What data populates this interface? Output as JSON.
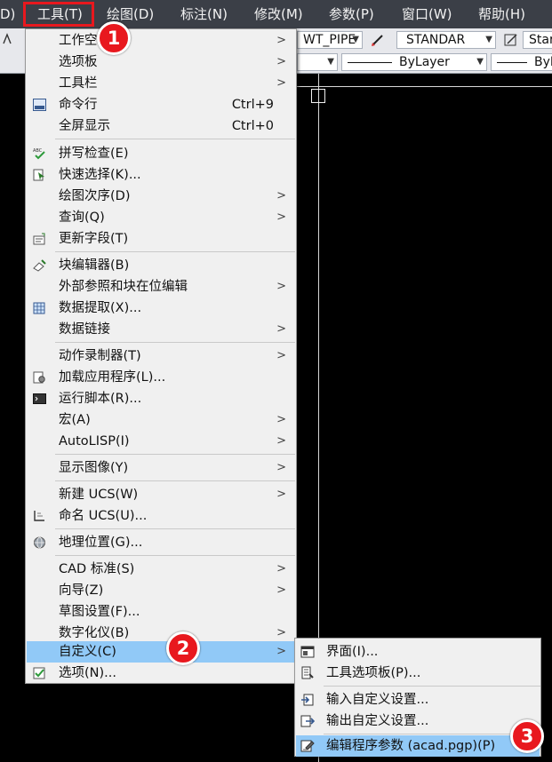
{
  "menubar": {
    "items": [
      "D)",
      "工具(T)",
      "绘图(D)",
      "标注(N)",
      "修改(M)",
      "参数(P)",
      "窗口(W)",
      "帮助(H)"
    ]
  },
  "toolbar1": {
    "combo1": "WT_PIPE",
    "combo2": "STANDAR",
    "combo3": "Star"
  },
  "toolbar2": {
    "combo1": "ByLayer",
    "combo2": "ByL"
  },
  "tools_menu": {
    "items": [
      {
        "label": "工作空间",
        "shortcut": "",
        "submenu": true
      },
      {
        "label": "选项板",
        "shortcut": "",
        "submenu": true
      },
      {
        "label": "工具栏",
        "shortcut": "",
        "submenu": true
      },
      {
        "label": "命令行",
        "shortcut": "Ctrl+9",
        "submenu": false
      },
      {
        "label": "全屏显示",
        "shortcut": "Ctrl+0",
        "submenu": false
      },
      {
        "label": "拼写检查(E)",
        "shortcut": "",
        "submenu": false
      },
      {
        "label": "快速选择(K)...",
        "shortcut": "",
        "submenu": false
      },
      {
        "label": "绘图次序(D)",
        "shortcut": "",
        "submenu": true
      },
      {
        "label": "查询(Q)",
        "shortcut": "",
        "submenu": true
      },
      {
        "label": "更新字段(T)",
        "shortcut": "",
        "submenu": false
      },
      {
        "label": "块编辑器(B)",
        "shortcut": "",
        "submenu": false
      },
      {
        "label": "外部参照和块在位编辑",
        "shortcut": "",
        "submenu": true
      },
      {
        "label": "数据提取(X)...",
        "shortcut": "",
        "submenu": false
      },
      {
        "label": "数据链接",
        "shortcut": "",
        "submenu": true
      },
      {
        "label": "动作录制器(T)",
        "shortcut": "",
        "submenu": true
      },
      {
        "label": "加载应用程序(L)...",
        "shortcut": "",
        "submenu": false
      },
      {
        "label": "运行脚本(R)...",
        "shortcut": "",
        "submenu": false
      },
      {
        "label": "宏(A)",
        "shortcut": "",
        "submenu": true
      },
      {
        "label": "AutoLISP(I)",
        "shortcut": "",
        "submenu": true
      },
      {
        "label": "显示图像(Y)",
        "shortcut": "",
        "submenu": true
      },
      {
        "label": "新建 UCS(W)",
        "shortcut": "",
        "submenu": true
      },
      {
        "label": "命名 UCS(U)...",
        "shortcut": "",
        "submenu": false
      },
      {
        "label": "地理位置(G)...",
        "shortcut": "",
        "submenu": false
      },
      {
        "label": "CAD 标准(S)",
        "shortcut": "",
        "submenu": true
      },
      {
        "label": "向导(Z)",
        "shortcut": "",
        "submenu": true
      },
      {
        "label": "草图设置(F)...",
        "shortcut": "",
        "submenu": false
      },
      {
        "label": "数字化仪(B)",
        "shortcut": "",
        "submenu": true
      },
      {
        "label": "自定义(C)",
        "shortcut": "",
        "submenu": true
      },
      {
        "label": "选项(N)...",
        "shortcut": "",
        "submenu": false
      }
    ]
  },
  "customize_submenu": {
    "items": [
      {
        "label": "界面(I)..."
      },
      {
        "label": "工具选项板(P)..."
      },
      {
        "label": "输入自定义设置..."
      },
      {
        "label": "输出自定义设置..."
      },
      {
        "label": "编辑程序参数 (acad.pgp)(P)"
      }
    ]
  },
  "badges": [
    "1",
    "2",
    "3"
  ],
  "colors": {
    "highlight": "#91c9f7",
    "annotation_red": "#e8181e",
    "menubar_bg": "#3b3f47"
  }
}
